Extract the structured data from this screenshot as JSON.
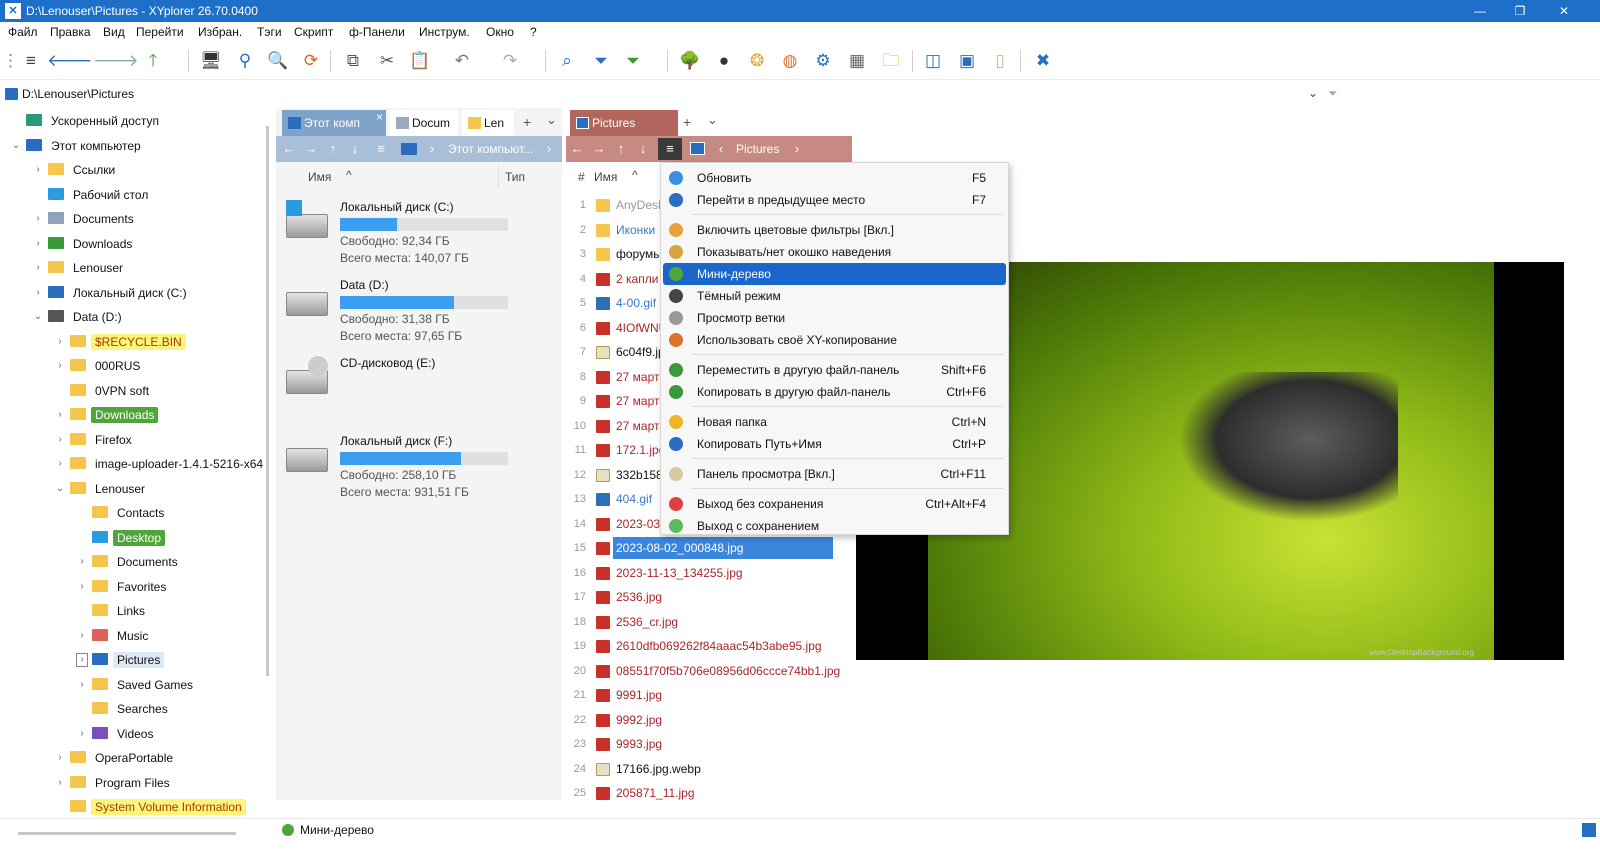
{
  "window": {
    "title": "D:\\Lenouser\\Pictures - XYplorer 26.70.0400"
  },
  "menu": [
    "Файл",
    "Правка",
    "Вид",
    "Перейти",
    "Избран.",
    "Тэги",
    "Скрипт",
    "ф-Панели",
    "Инструм.",
    "Окно",
    "?"
  ],
  "address": {
    "path": "D:\\Lenouser\\Pictures"
  },
  "tree": {
    "items": [
      {
        "label": "Ускоренный доступ",
        "level": 0,
        "icon": "gear-icon"
      },
      {
        "label": "Этот компьютер",
        "level": 0,
        "icon": "computer-icon",
        "exp": "v"
      },
      {
        "label": "Ссылки",
        "level": 1,
        "icon": "folder-icon",
        "exp": ">"
      },
      {
        "label": "Рабочий стол",
        "level": 1,
        "icon": "desktop-icon"
      },
      {
        "label": "Documents",
        "level": 1,
        "icon": "document-icon",
        "exp": ">"
      },
      {
        "label": "Downloads",
        "level": 1,
        "icon": "download-icon",
        "exp": ">"
      },
      {
        "label": "Lenouser",
        "level": 1,
        "icon": "folder-icon",
        "exp": ">"
      },
      {
        "label": "Локальный диск (C:)",
        "level": 1,
        "icon": "windows-drive-icon",
        "exp": ">"
      },
      {
        "label": "Data (D:)",
        "level": 1,
        "icon": "drive-icon",
        "exp": "v"
      },
      {
        "label": "$RECYCLE.BIN",
        "level": 2,
        "icon": "folder-icon",
        "exp": ">",
        "hl": "yellow"
      },
      {
        "label": "000RUS",
        "level": 2,
        "icon": "folder-icon",
        "exp": ">"
      },
      {
        "label": "0VPN soft",
        "level": 2,
        "icon": "folder-icon"
      },
      {
        "label": "Downloads",
        "level": 2,
        "icon": "folder-icon",
        "exp": ">",
        "hl": "green"
      },
      {
        "label": "Firefox",
        "level": 2,
        "icon": "folder-icon",
        "exp": ">"
      },
      {
        "label": "image-uploader-1.4.1-5216-x64",
        "level": 2,
        "icon": "folder-icon",
        "exp": ">"
      },
      {
        "label": "Lenouser",
        "level": 2,
        "icon": "folder-icon",
        "exp": "v"
      },
      {
        "label": "Contacts",
        "level": 3,
        "icon": "folder-icon"
      },
      {
        "label": "Desktop",
        "level": 3,
        "icon": "desktop-icon",
        "hl": "green"
      },
      {
        "label": "Documents",
        "level": 3,
        "icon": "folder-icon",
        "exp": ">"
      },
      {
        "label": "Favorites",
        "level": 3,
        "icon": "folder-icon",
        "exp": ">"
      },
      {
        "label": "Links",
        "level": 3,
        "icon": "folder-icon"
      },
      {
        "label": "Music",
        "level": 3,
        "icon": "music-icon",
        "exp": ">"
      },
      {
        "label": "Pictures",
        "level": 3,
        "icon": "pictures-icon",
        "exp": ">",
        "hl": "selected"
      },
      {
        "label": "Saved Games",
        "level": 3,
        "icon": "folder-icon",
        "exp": ">"
      },
      {
        "label": "Searches",
        "level": 3,
        "icon": "folder-icon"
      },
      {
        "label": "Videos",
        "level": 3,
        "icon": "video-icon",
        "exp": ">"
      },
      {
        "label": "OperaPortable",
        "level": 2,
        "icon": "folder-icon",
        "exp": ">"
      },
      {
        "label": "Program Files",
        "level": 2,
        "icon": "folder-icon",
        "exp": ">"
      },
      {
        "label": "System Volume Information",
        "level": 2,
        "icon": "folder-icon",
        "hl": "yellow"
      }
    ]
  },
  "pane1": {
    "tabs": [
      "Этот комп",
      "Docum",
      "Len"
    ],
    "add": "+",
    "drop": "⌄",
    "crumb": "Этот компьют...",
    "col_name": "Имя",
    "col_type": "Тип",
    "drives": [
      {
        "name": "Локальный диск (C:)",
        "free": "Свободно: 92,34 ГБ",
        "total": "Всего места: 140,07 ГБ",
        "used": 0.34
      },
      {
        "name": "Data (D:)",
        "free": "Свободно: 31,38 ГБ",
        "total": "Всего места: 97,65 ГБ",
        "used": 0.68
      },
      {
        "name": "CD-дисковод (E:)",
        "free": "",
        "total": "",
        "used": 0
      },
      {
        "name": "Локальный диск (F:)",
        "free": "Свободно: 258,10 ГБ",
        "total": "Всего места: 931,51 ГБ",
        "used": 0.72
      }
    ]
  },
  "pane2": {
    "tab": "Pictures",
    "add": "+",
    "drop": "⌄",
    "crumb": "Pictures",
    "col_num": "#",
    "col_name": "Имя",
    "files": [
      {
        "n": "1",
        "name": "AnyDesk",
        "type": "folder"
      },
      {
        "n": "2",
        "name": "Иконки",
        "type": "folder-blue"
      },
      {
        "n": "3",
        "name": "форумы",
        "type": "folder"
      },
      {
        "n": "4",
        "name": "2 капли",
        "type": "jpg"
      },
      {
        "n": "5",
        "name": "4-00.gif",
        "type": "gif"
      },
      {
        "n": "6",
        "name": "4IOfWNU",
        "type": "jpg"
      },
      {
        "n": "7",
        "name": "6c04f9.jp",
        "type": "webp"
      },
      {
        "n": "8",
        "name": "27 марта",
        "type": "jpg"
      },
      {
        "n": "9",
        "name": "27 марта",
        "type": "jpg"
      },
      {
        "n": "10",
        "name": "27 марта",
        "type": "jpg"
      },
      {
        "n": "11",
        "name": "172.1.jpg",
        "type": "jpg"
      },
      {
        "n": "12",
        "name": "332b158f",
        "type": "webp"
      },
      {
        "n": "13",
        "name": "404.gif",
        "type": "gif"
      },
      {
        "n": "14",
        "name": "2023-03-",
        "type": "jpg"
      },
      {
        "n": "15",
        "name": "2023-08-02_000848.jpg",
        "type": "jpg",
        "sel": true
      },
      {
        "n": "16",
        "name": "2023-11-13_134255.jpg",
        "type": "jpg"
      },
      {
        "n": "17",
        "name": "2536.jpg",
        "type": "jpg"
      },
      {
        "n": "18",
        "name": "2536_cr.jpg",
        "type": "jpg"
      },
      {
        "n": "19",
        "name": "2610dfb069262f84aaac54b3abe95.jpg",
        "type": "jpg"
      },
      {
        "n": "20",
        "name": "08551f70f5b706e08956d06ccce74bb1.jpg",
        "type": "jpg"
      },
      {
        "n": "21",
        "name": "9991.jpg",
        "type": "jpg"
      },
      {
        "n": "22",
        "name": "9992.jpg",
        "type": "jpg"
      },
      {
        "n": "23",
        "name": "9993.jpg",
        "type": "jpg"
      },
      {
        "n": "24",
        "name": "17166.jpg.webp",
        "type": "webp"
      },
      {
        "n": "25",
        "name": "205871_11.jpg",
        "type": "jpg"
      }
    ]
  },
  "preview": {
    "watermark": "www.DesktopBackground.org"
  },
  "context_menu": {
    "items": [
      {
        "label": "Обновить",
        "shortcut": "F5",
        "icon": "refresh-icon",
        "color": "#3c8ee0"
      },
      {
        "label": "Перейти в предыдущее место",
        "shortcut": "F7",
        "icon": "back-icon",
        "color": "#2a6cc0"
      },
      {
        "sep": true
      },
      {
        "label": "Включить цветовые фильтры [Вкл.]",
        "shortcut": "",
        "icon": "color-filter-icon",
        "color": "#e8a23a"
      },
      {
        "label": "Показывать/нет окошко наведения",
        "shortcut": "",
        "icon": "hover-box-icon",
        "color": "#d9a440"
      },
      {
        "label": "Мини-дерево",
        "shortcut": "",
        "icon": "mini-tree-icon",
        "color": "#4fa53a",
        "selected": true
      },
      {
        "label": "Тёмный режим",
        "shortcut": "",
        "icon": "dark-mode-icon",
        "color": "#444"
      },
      {
        "label": "Просмотр ветки",
        "shortcut": "",
        "icon": "branch-view-icon",
        "color": "#9a9a9a"
      },
      {
        "label": "Использовать своё XY-копирование",
        "shortcut": "",
        "icon": "xy-copy-icon",
        "color": "#e07030"
      },
      {
        "sep": true
      },
      {
        "label": "Переместить в другую файл-панель",
        "shortcut": "Shift+F6",
        "icon": "move-pane-icon",
        "color": "#3a9a3a"
      },
      {
        "label": "Копировать в другую файл-панель",
        "shortcut": "Ctrl+F6",
        "icon": "copy-pane-icon",
        "color": "#3a9a3a"
      },
      {
        "sep": true
      },
      {
        "label": "Новая папка",
        "shortcut": "Ctrl+N",
        "icon": "new-folder-icon",
        "color": "#f0b429"
      },
      {
        "label": "Копировать Путь+Имя",
        "shortcut": "Ctrl+P",
        "icon": "copy-path-icon",
        "color": "#2a6cc0"
      },
      {
        "sep": true
      },
      {
        "label": "Панель просмотра [Вкл.]",
        "shortcut": "Ctrl+F11",
        "icon": "preview-pane-icon",
        "color": "#d8c9a0"
      },
      {
        "sep": true
      },
      {
        "label": "Выход без сохранения",
        "shortcut": "Ctrl+Alt+F4",
        "icon": "exit-no-save-icon",
        "color": "#e04040"
      },
      {
        "label": "Выход с сохранением",
        "shortcut": "",
        "icon": "exit-save-icon",
        "color": "#5dbb5d"
      }
    ]
  },
  "status": {
    "text": "Мини-дерево"
  }
}
